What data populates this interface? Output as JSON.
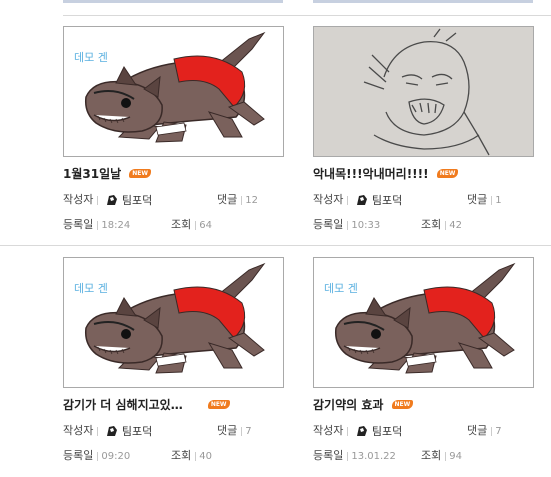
{
  "labels": {
    "author": "작성자",
    "comments": "댓글",
    "date": "등록일",
    "views": "조회",
    "new_badge": "NEW"
  },
  "posts": [
    {
      "title": "1월31일날",
      "author": "팀포덕",
      "comments": "12",
      "date": "18:24",
      "views": "64",
      "thumb_text": "데모 겐",
      "image_icon": "cartoon-dog-image"
    },
    {
      "title": "악내목!!!악내머리!!!!",
      "author": "팀포덕",
      "comments": "1",
      "date": "10:33",
      "views": "42",
      "image_icon": "sketch-drawing-image"
    },
    {
      "title": "감기가 더 심해지고있…",
      "author": "팀포덕",
      "comments": "7",
      "date": "09:20",
      "views": "40",
      "thumb_text": "데모 겐",
      "image_icon": "cartoon-dog-image"
    },
    {
      "title": "감기약의 효과",
      "author": "팀포덕",
      "comments": "7",
      "date": "13.01.22",
      "views": "94",
      "thumb_text": "데모 겐",
      "image_icon": "cartoon-dog-image"
    }
  ]
}
